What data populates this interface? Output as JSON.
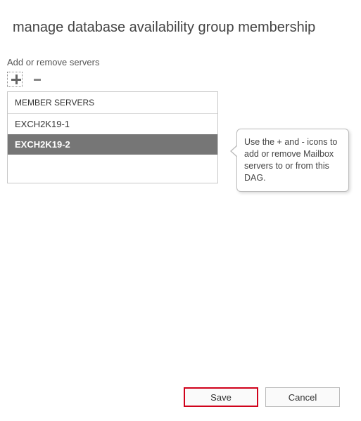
{
  "title": "manage database availability group membership",
  "subtitle": "Add or remove servers",
  "list": {
    "header": "MEMBER SERVERS",
    "items": [
      {
        "name": "EXCH2K19-1",
        "selected": false
      },
      {
        "name": "EXCH2K19-2",
        "selected": true
      }
    ]
  },
  "callout": "Use the + and - icons to add or remove Mailbox servers to or from this DAG.",
  "buttons": {
    "save": "Save",
    "cancel": "Cancel"
  }
}
